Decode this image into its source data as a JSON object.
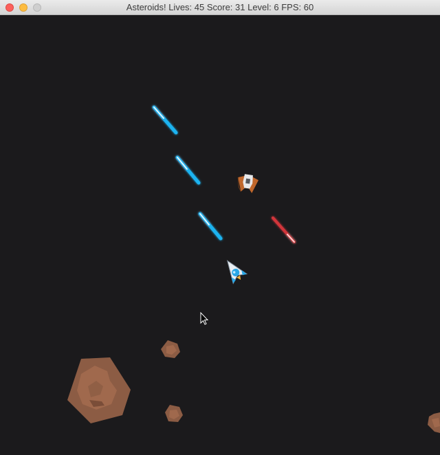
{
  "window": {
    "title": "Asteroids! Lives: 45 Score: 31 Level: 6 FPS: 60",
    "controls": [
      "close",
      "minimize",
      "zoom"
    ]
  },
  "game": {
    "background_color": "#1b1a1c",
    "laser_color_player": "#1fb3f0",
    "laser_color_enemy": "#d2363a",
    "asteroid_color": "#8c5c44",
    "asteroid_detail_color": "#a0694d",
    "ship_accent_color": "#2aa7e6",
    "enemy_color": "#c0672c",
    "cursor_icon": "mouse-pointer-icon"
  }
}
